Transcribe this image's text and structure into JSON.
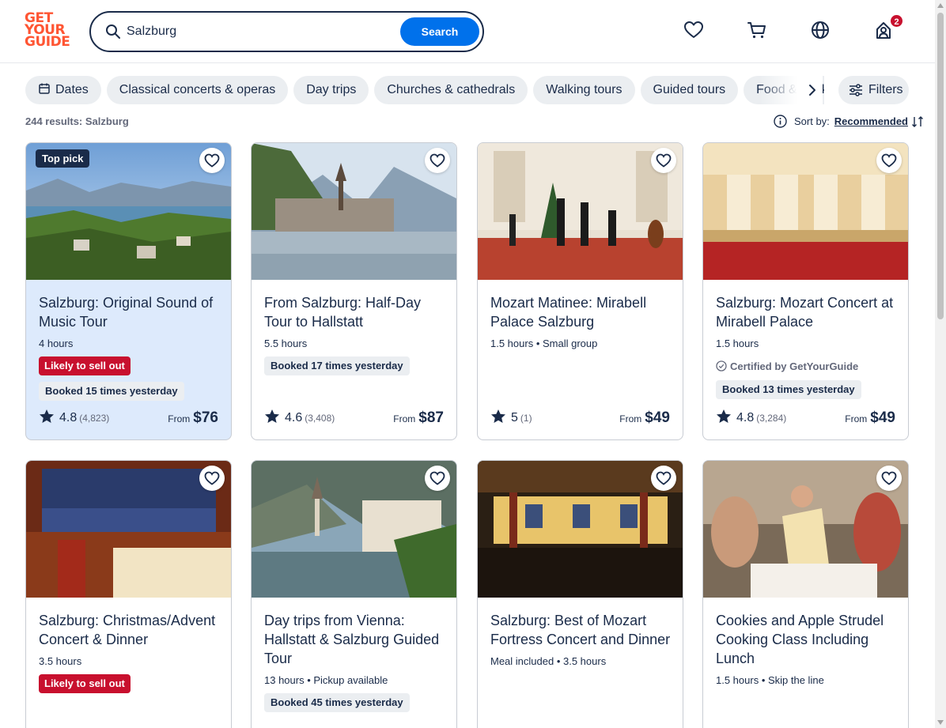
{
  "header": {
    "logo_lines": [
      "GET",
      "YOUR",
      "GUIDE"
    ],
    "search_value": "Salzburg",
    "search_button": "Search",
    "cart_badge": "2"
  },
  "filters": {
    "chips": [
      "Dates",
      "Classical concerts & operas",
      "Day trips",
      "Churches & cathedrals",
      "Walking tours",
      "Guided tours",
      "Food & drink"
    ],
    "filters_label": "Filters"
  },
  "results": {
    "count_text": "244 results: Salzburg",
    "sort_label": "Sort by:",
    "sort_value": "Recommended"
  },
  "cards": [
    {
      "title": "Salzburg: Original Sound of Music Tour",
      "meta": "4 hours",
      "top_pick": "Top pick",
      "sell_out": "Likely to sell out",
      "booked": "Booked 15 times yesterday",
      "rating": "4.8",
      "reviews": "(4,823)",
      "from": "From",
      "price": "$76"
    },
    {
      "title": "From Salzburg: Half-Day Tour to Hallstatt",
      "meta": "5.5 hours",
      "booked": "Booked 17 times yesterday",
      "rating": "4.6",
      "reviews": "(3,408)",
      "from": "From",
      "price": "$87"
    },
    {
      "title": "Mozart Matinee: Mirabell Palace Salzburg",
      "meta": "1.5 hours • Small group",
      "rating": "5",
      "reviews": "(1)",
      "from": "From",
      "price": "$49"
    },
    {
      "title": "Salzburg: Mozart Concert at Mirabell Palace",
      "meta": "1.5 hours",
      "certified": "Certified by GetYourGuide",
      "booked": "Booked 13 times yesterday",
      "rating": "4.8",
      "reviews": "(3,284)",
      "from": "From",
      "price": "$49"
    },
    {
      "title": "Salzburg: Christmas/Advent Concert & Dinner",
      "meta": "3.5 hours",
      "sell_out": "Likely to sell out"
    },
    {
      "title": "Day trips from Vienna: Hallstatt & Salzburg Guided Tour",
      "meta": "13 hours • Pickup available",
      "booked": "Booked 45 times yesterday"
    },
    {
      "title": "Salzburg: Best of Mozart Fortress Concert and Dinner",
      "meta": "Meal included • 3.5 hours"
    },
    {
      "title": "Cookies and Apple Strudel Cooking Class Including Lunch",
      "meta": "1.5 hours • Skip the line"
    }
  ],
  "colors": {
    "brand": "#ff5533",
    "accent": "#0071eb",
    "ink": "#1a2b49",
    "sell_out": "#c8102e",
    "chip_bg": "#ebeef1",
    "highlight": "#ddeafc"
  },
  "icons": [
    "search-icon",
    "heart-icon",
    "cart-icon",
    "globe-icon",
    "profile-icon",
    "calendar-icon",
    "chevron-right-icon",
    "sliders-icon",
    "info-icon",
    "sort-icon",
    "star-icon",
    "certified-icon"
  ]
}
